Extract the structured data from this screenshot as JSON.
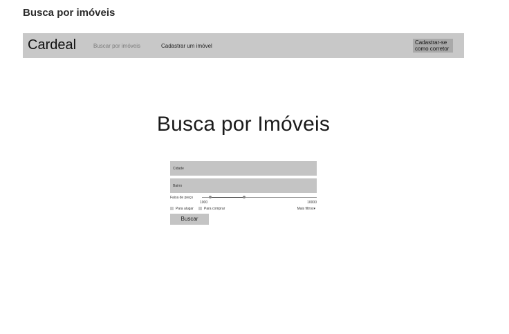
{
  "page": {
    "title": "Busca por imóveis"
  },
  "navbar": {
    "brand": "Cardeal",
    "links": [
      "Buscar por imóveis",
      "Cadastrar um imóvel"
    ],
    "cta_line1": "Cadastrar-se",
    "cta_line2": "como corretor"
  },
  "hero": {
    "title": "Busca por Imóveis"
  },
  "form": {
    "city_placeholder": "Cidade",
    "neighborhood_placeholder": "Bairro",
    "price_label": "Faixa de preço",
    "price_min": "1000",
    "price_max": "10000",
    "rent_label": "Para alugar",
    "buy_label": "Para comprar",
    "more_filters": "Mais filtros",
    "more_filters_icon": "▾",
    "search_button": "Buscar"
  },
  "colors": {
    "navbar_bg": "#c8c8c8",
    "field_bg": "#c4c4c4",
    "cta_bg": "#a9a9a9"
  }
}
